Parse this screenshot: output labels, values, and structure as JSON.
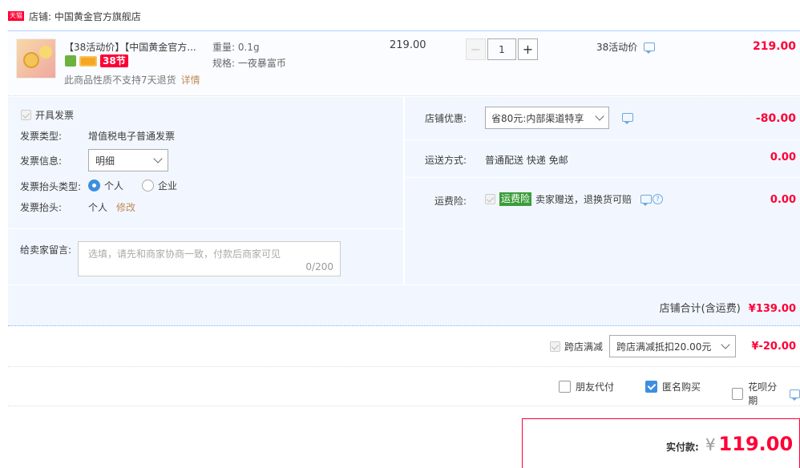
{
  "shop": {
    "badge": "天猫",
    "label": "店铺: 中国黄金官方旗舰店"
  },
  "item": {
    "title": "【38活动价】【中国黄金官方...",
    "tag_38": "38节",
    "no_return": "此商品性质不支持7天退货",
    "detail_link": "详情",
    "weight": "重量: 0.1g",
    "spec": "规格: 一夜暴富币",
    "unit_price": "219.00",
    "quantity": "1",
    "promo_label": "38活动价",
    "subtotal": "219.00"
  },
  "invoice": {
    "open_label": "开具发票",
    "type_label": "发票类型:",
    "type_value": "增值税电子普通发票",
    "info_label": "发票信息:",
    "info_value": "明细",
    "head_type_label": "发票抬头类型:",
    "head_options": [
      "个人",
      "企业"
    ],
    "head_label": "发票抬头:",
    "head_value": "个人",
    "edit_link": "修改"
  },
  "message": {
    "label": "给卖家留言:",
    "placeholder": "选填，请先和商家协商一致，付款后商家可见",
    "counter": "0/200"
  },
  "discount": {
    "label": "店铺优惠:",
    "value": "省80元:内部渠道特享",
    "amount": "-80.00"
  },
  "shipping": {
    "label": "运送方式:",
    "value": "普通配送 快递 免邮",
    "amount": "0.00"
  },
  "insurance": {
    "label": "运费险:",
    "badge": "运费险",
    "text": "卖家赠送，退换货可赔",
    "amount": "0.00"
  },
  "shop_total": {
    "label": "店铺合计(含运费)",
    "amount": "¥139.00"
  },
  "cross": {
    "label": "跨店满减",
    "value": "跨店满减抵扣20.00元",
    "amount": "¥-20.00"
  },
  "options": {
    "friend_pay": "朋友代付",
    "anonymous": "匿名购买",
    "huabei": "花呗分期"
  },
  "pay": {
    "label": "实付款:",
    "currency": "¥",
    "amount": "119.00"
  },
  "colors": {
    "accent_red": "#ff0036",
    "panel_bg": "#f2f7ff",
    "link_orange": "#c0895a"
  }
}
